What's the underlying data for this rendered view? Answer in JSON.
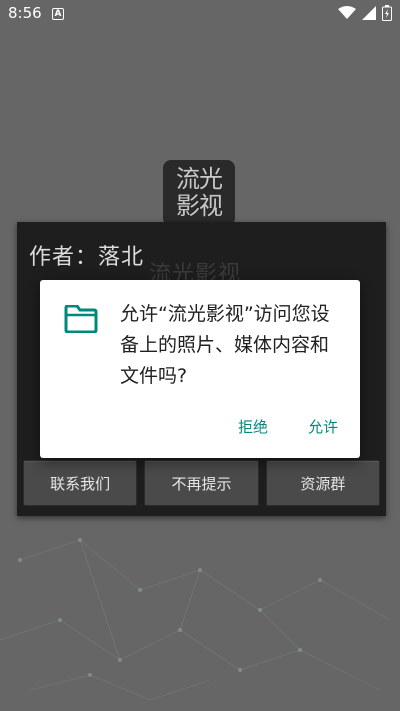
{
  "status_bar": {
    "time": "8:56",
    "notification_icon": "a-icon",
    "icons": [
      "wifi-icon",
      "signal-icon",
      "battery-icon"
    ]
  },
  "app": {
    "logo_text": "流光影视"
  },
  "notice_dialog": {
    "title": "作者：落北",
    "subtitle": "流光影视",
    "buttons": [
      "联系我们",
      "不再提示",
      "资源群"
    ]
  },
  "permission_dialog": {
    "icon": "folder-icon",
    "message": "允许“流光影视”访问您设备上的照片、媒体内容和文件吗?",
    "deny_label": "拒绝",
    "allow_label": "允许"
  },
  "colors": {
    "accent": "#00897b",
    "overlay": "#666666",
    "dialog_dark": "#1e1e1e"
  }
}
